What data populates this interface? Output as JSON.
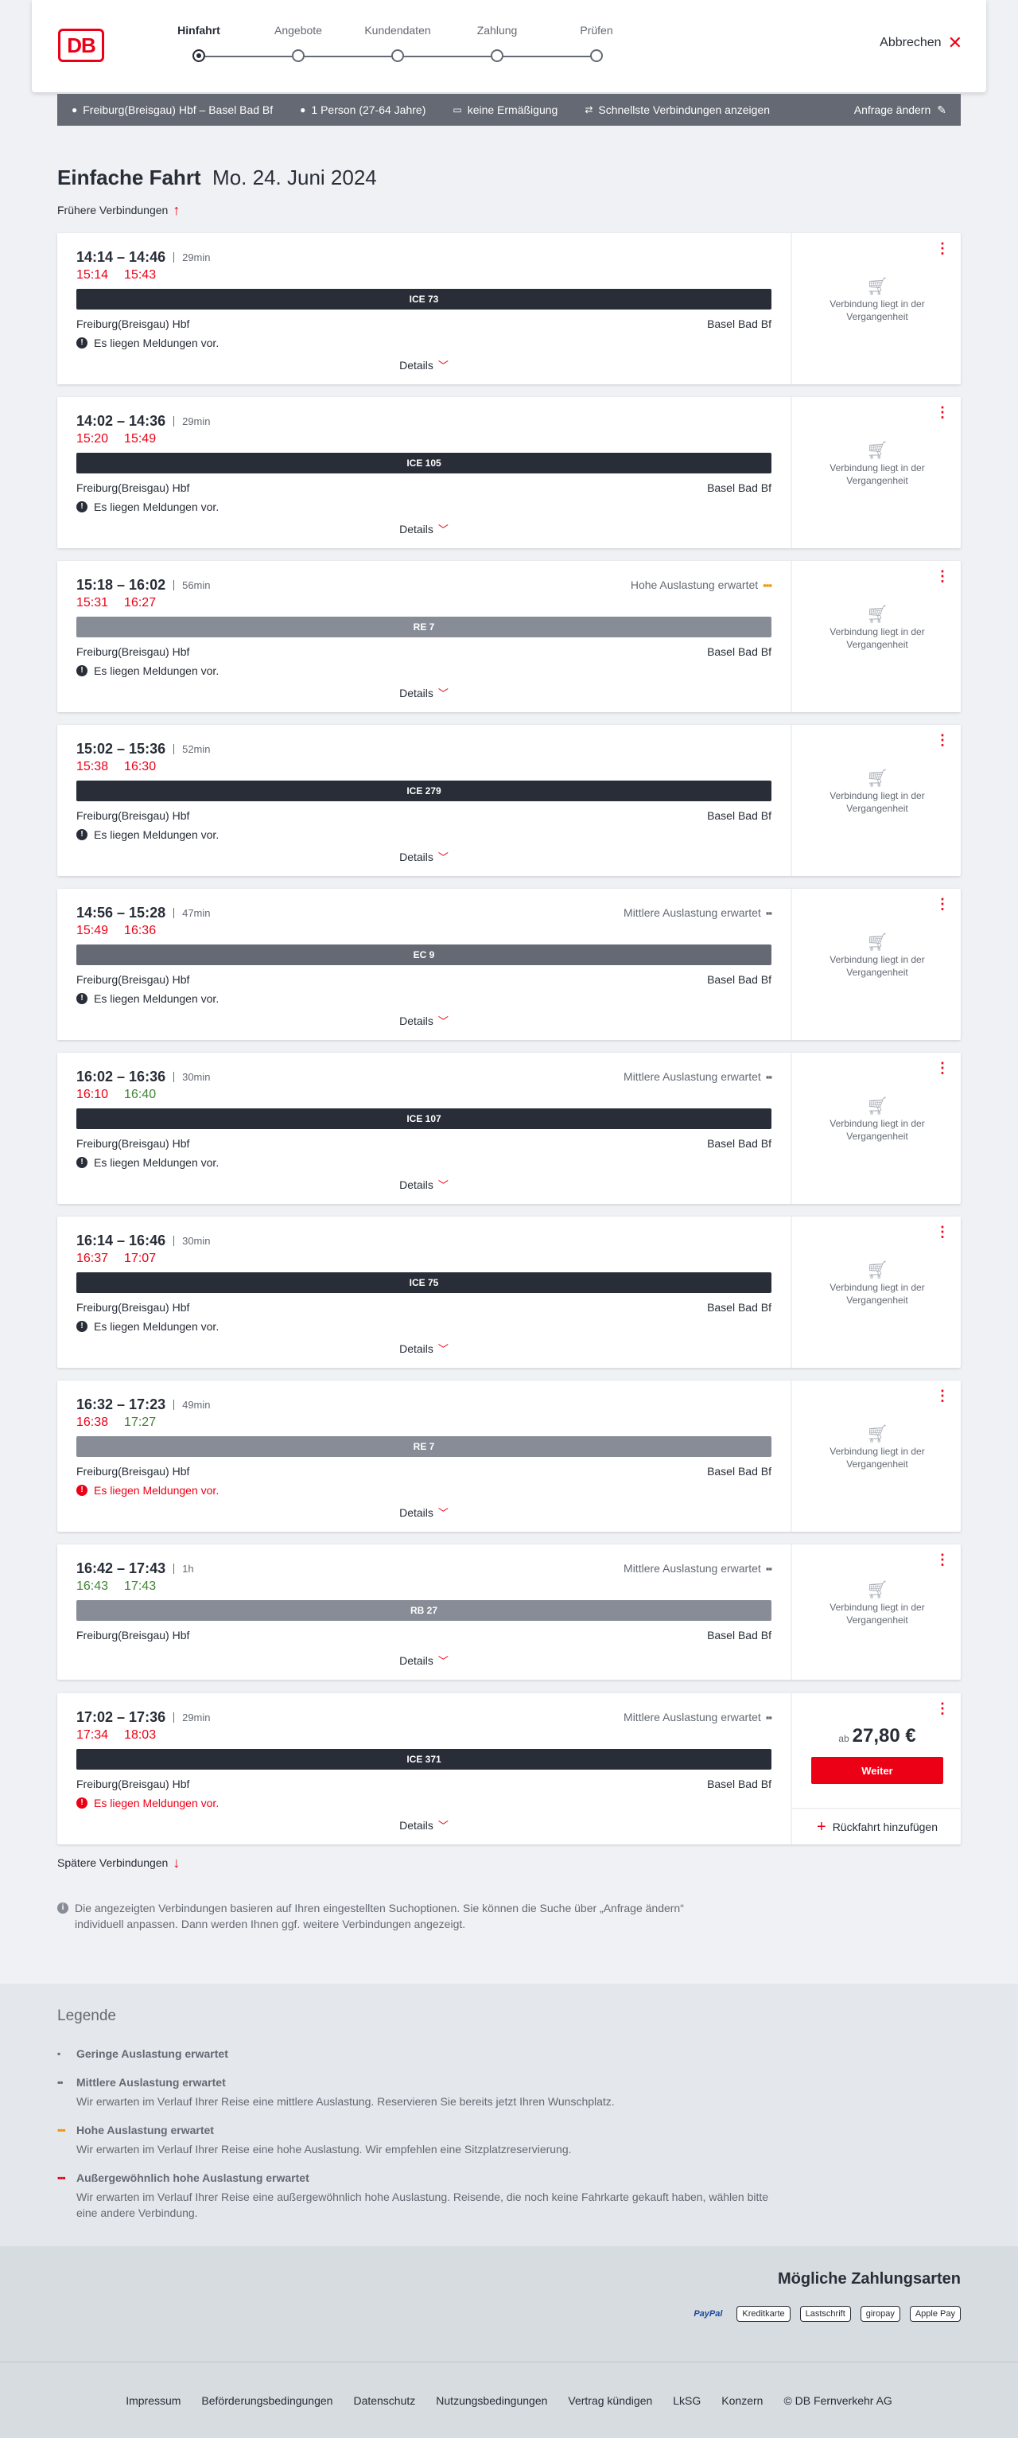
{
  "header": {
    "logo": "DB",
    "cancel": "Abbrechen",
    "steps": [
      {
        "label": "Hinfahrt",
        "active": true
      },
      {
        "label": "Angebote"
      },
      {
        "label": "Kundendaten"
      },
      {
        "label": "Zahlung"
      },
      {
        "label": "Prüfen"
      }
    ]
  },
  "infobar": {
    "route": "Freiburg(Breisgau) Hbf – Basel Bad Bf",
    "persons": "1 Person (27-64 Jahre)",
    "discount": "keine Ermäßigung",
    "fastest": "Schnellste Verbindungen anzeigen",
    "change": "Anfrage ändern"
  },
  "page": {
    "title": "Einfache Fahrt",
    "date": "Mo. 24. Juni 2024",
    "earlier": "Frühere Verbindungen",
    "later": "Spätere Verbindungen",
    "note": "Die angezeigten Verbindungen basieren auf Ihren eingestellten Suchoptionen. Sie können die Suche über „Anfrage ändern“ individuell anpassen. Dann werden Ihnen ggf. weitere Verbindungen angezeigt."
  },
  "common": {
    "from": "Freiburg(Breisgau) Hbf",
    "to": "Basel Bad Bf",
    "details": "Details",
    "past": "Verbindung liegt in der Vergangenheit",
    "price_prefix": "ab",
    "weiter": "Weiter",
    "rueck": "Rückfahrt hinzufügen"
  },
  "connections": [
    {
      "times": "14:14 – 14:46",
      "dur": "29min",
      "rt1": "15:14",
      "rt2": "15:43",
      "c1": "red",
      "c2": "red",
      "train": "ICE 73",
      "bar": "dark",
      "msg": "Es liegen Meldungen vor.",
      "msgWarn": false,
      "load": ""
    },
    {
      "times": "14:02 – 14:36",
      "dur": "29min",
      "rt1": "15:20",
      "rt2": "15:49",
      "c1": "red",
      "c2": "red",
      "train": "ICE 105",
      "bar": "dark",
      "msg": "Es liegen Meldungen vor.",
      "msgWarn": false,
      "load": ""
    },
    {
      "times": "15:18 – 16:02",
      "dur": "56min",
      "rt1": "15:31",
      "rt2": "16:27",
      "c1": "red",
      "c2": "red",
      "train": "RE 7",
      "bar": "grey",
      "msg": "Es liegen Meldungen vor.",
      "msgWarn": false,
      "load": "Hohe Auslastung erwartet",
      "loadLevel": "high"
    },
    {
      "times": "15:02 – 15:36",
      "dur": "52min",
      "rt1": "15:38",
      "rt2": "16:30",
      "c1": "red",
      "c2": "red",
      "train": "ICE 279",
      "bar": "dark",
      "msg": "Es liegen Meldungen vor.",
      "msgWarn": false,
      "load": ""
    },
    {
      "times": "14:56 – 15:28",
      "dur": "47min",
      "rt1": "15:49",
      "rt2": "16:36",
      "c1": "red",
      "c2": "red",
      "train": "EC 9",
      "bar": "mid",
      "msg": "Es liegen Meldungen vor.",
      "msgWarn": false,
      "load": "Mittlere Auslastung erwartet",
      "loadLevel": "mid"
    },
    {
      "times": "16:02 – 16:36",
      "dur": "30min",
      "rt1": "16:10",
      "rt2": "16:40",
      "c1": "red",
      "c2": "green",
      "train": "ICE 107",
      "bar": "dark",
      "msg": "Es liegen Meldungen vor.",
      "msgWarn": false,
      "load": "Mittlere Auslastung erwartet",
      "loadLevel": "mid"
    },
    {
      "times": "16:14 – 16:46",
      "dur": "30min",
      "rt1": "16:37",
      "rt2": "17:07",
      "c1": "red",
      "c2": "red",
      "train": "ICE 75",
      "bar": "dark",
      "msg": "Es liegen Meldungen vor.",
      "msgWarn": false,
      "load": ""
    },
    {
      "times": "16:32 – 17:23",
      "dur": "49min",
      "rt1": "16:38",
      "rt2": "17:27",
      "c1": "red",
      "c2": "green",
      "train": "RE 7",
      "bar": "grey",
      "msg": "Es liegen Meldungen vor.",
      "msgWarn": true,
      "load": ""
    },
    {
      "times": "16:42 – 17:43",
      "dur": "1h",
      "rt1": "16:43",
      "rt2": "17:43",
      "c1": "green",
      "c2": "green",
      "train": "RB 27",
      "bar": "grey",
      "msg": "",
      "msgWarn": false,
      "load": "Mittlere Auslastung erwartet",
      "loadLevel": "mid"
    },
    {
      "times": "17:02 – 17:36",
      "dur": "29min",
      "rt1": "17:34",
      "rt2": "18:03",
      "c1": "red",
      "c2": "red",
      "train": "ICE 371",
      "bar": "dark",
      "msg": "Es liegen Meldungen vor.",
      "msgWarn": true,
      "load": "Mittlere Auslastung erwartet",
      "loadLevel": "mid",
      "price": "27,80 €"
    }
  ],
  "legend": {
    "title": "Legende",
    "items": [
      {
        "title": "Geringe Auslastung erwartet",
        "text": ""
      },
      {
        "title": "Mittlere Auslastung erwartet",
        "text": "Wir erwarten im Verlauf Ihrer Reise eine mittlere Auslastung. Reservieren Sie bereits jetzt Ihren Wunschplatz."
      },
      {
        "title": "Hohe Auslastung erwartet",
        "text": "Wir erwarten im Verlauf Ihrer Reise eine hohe Auslastung. Wir empfehlen eine Sitzplatzreservierung."
      },
      {
        "title": "Außergewöhnlich hohe Auslastung erwartet",
        "text": "Wir erwarten im Verlauf Ihrer Reise eine außergewöhnlich hohe Auslastung. Reisende, die noch keine Fahrkarte gekauft haben, wählen bitte eine andere Verbindung."
      }
    ]
  },
  "payment": {
    "title": "Mögliche Zahlungsarten",
    "methods": [
      "PayPal",
      "Kreditkarte",
      "Lastschrift",
      "giropay",
      "Apple Pay"
    ]
  },
  "footer": [
    "Impressum",
    "Beförderungsbedingungen",
    "Datenschutz",
    "Nutzungsbedingungen",
    "Vertrag kündigen",
    "LkSG",
    "Konzern",
    "© DB Fernverkehr AG"
  ],
  "colors": {
    "red": "#ec0016",
    "dark": "#282d37",
    "green": "#408335"
  }
}
